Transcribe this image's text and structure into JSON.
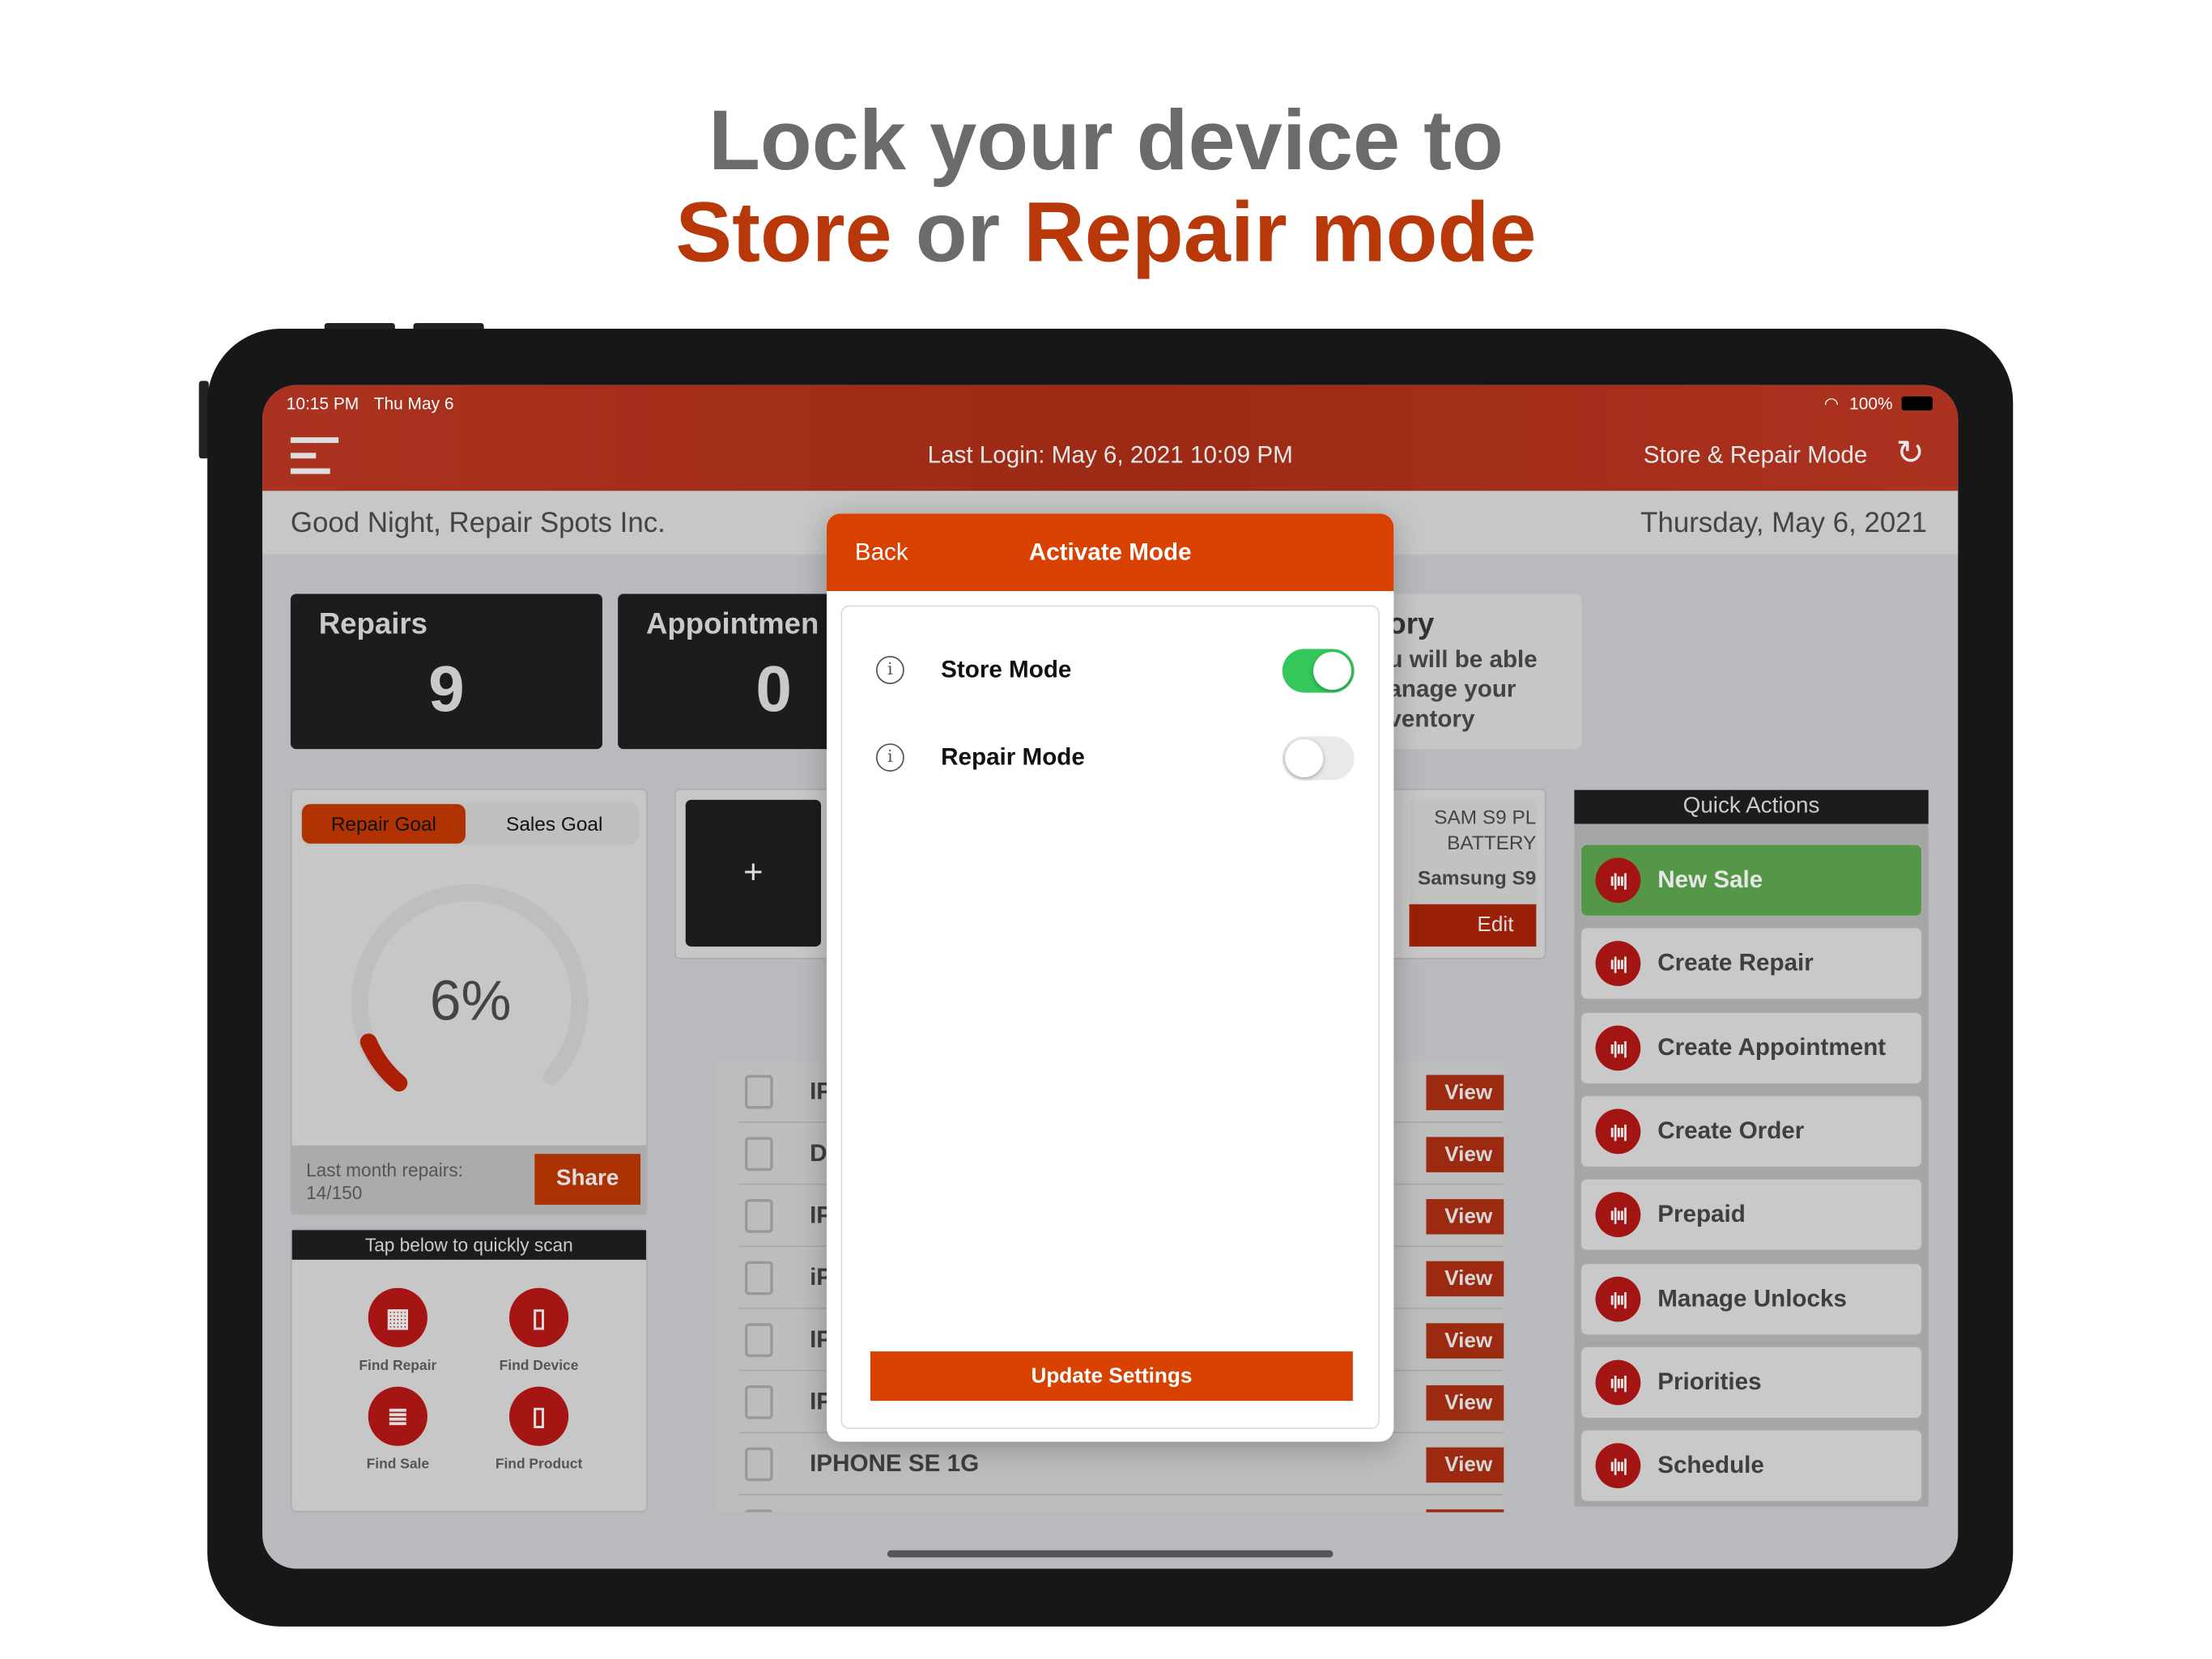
{
  "headline": {
    "line1": "Lock your device to",
    "store": "Store",
    "or": "or",
    "repair": "Repair mode"
  },
  "status_bar": {
    "time": "10:15 PM",
    "date": "Thu May 6",
    "battery": "100%"
  },
  "nav": {
    "last_login": "Last Login: May 6, 2021 10:09 PM",
    "mode_label": "Store & Repair Mode"
  },
  "greeting": {
    "text": "Good Night, Repair Spots Inc.",
    "date": "Thursday, May 6, 2021"
  },
  "stats": [
    {
      "label": "Repairs",
      "value": "9"
    },
    {
      "label": "Appointmen",
      "value": "0"
    }
  ],
  "inventory_card": {
    "title": "ory",
    "text_lines": [
      "u will be able",
      "anage your",
      "ventory"
    ]
  },
  "goal": {
    "tabs": [
      "Repair Goal",
      "Sales Goal"
    ],
    "active_tab": "Repair Goal",
    "percent_label": "6%",
    "percent": 6,
    "footer_label": "Last month repairs:",
    "footer_value": "14/150",
    "share": "Share"
  },
  "scan": {
    "title": "Tap below to quickly scan",
    "items": [
      "Find Repair",
      "Find Device",
      "Find Sale",
      "Find Product"
    ]
  },
  "product": {
    "add": "+",
    "name_lines": [
      "SAM S9 PL",
      "BATTERY"
    ],
    "model": "Samsung S9",
    "edit": "Edit"
  },
  "list": {
    "rows": [
      "IPH",
      "DJI",
      "IPH",
      "iPh",
      "IPH",
      "IPH",
      "IPHONE SE 1G"
    ],
    "view_label": "View"
  },
  "quick_actions": {
    "title": "Quick Actions",
    "items": [
      "New Sale",
      "Create Repair",
      "Create Appointment",
      "Create Order",
      "Prepaid",
      "Manage Unlocks",
      "Priorities",
      "Schedule"
    ]
  },
  "modal": {
    "back": "Back",
    "title": "Activate Mode",
    "modes": [
      {
        "label": "Store Mode",
        "on": true
      },
      {
        "label": "Repair Mode",
        "on": false
      }
    ],
    "update": "Update Settings",
    "info_glyph": "i"
  },
  "colors": {
    "brand_red": "#a8321e",
    "modal_orange": "#d84100",
    "toggle_on": "#34c759",
    "quick_sale_green": "#549747"
  }
}
